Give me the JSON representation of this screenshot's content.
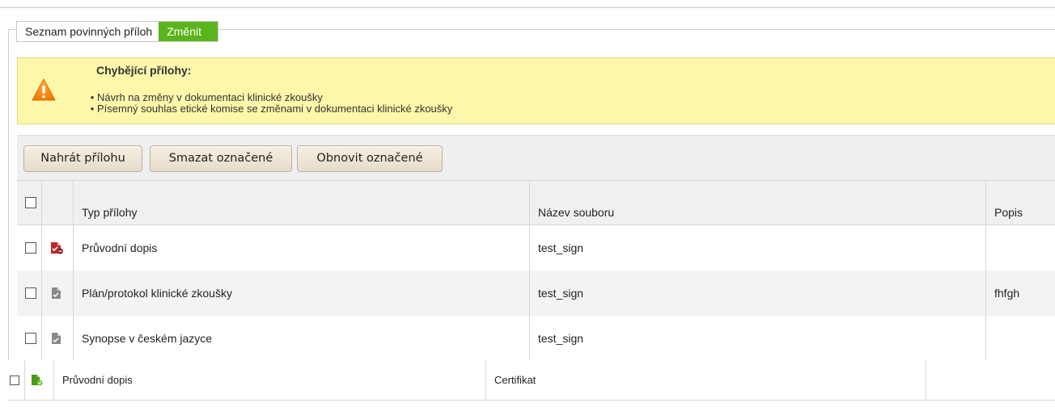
{
  "section": {
    "title": "Seznam povinných příloh",
    "action_label": "Změnit"
  },
  "warning": {
    "title": "Chybějící přílohy:",
    "items": [
      "Návrh na změny v dokumentaci klinické zkoušky",
      "Písemný souhlas etické komise se změnami v dokumentaci klinické zkoušky"
    ]
  },
  "toolbar": {
    "upload_label": "Nahrát přílohu",
    "delete_label": "Smazat označené",
    "restore_label": "Obnovit označené"
  },
  "table": {
    "columns": {
      "type": "Typ přílohy",
      "filename": "Název souboru",
      "description": "Popis"
    },
    "rows": [
      {
        "type": "Průvodní dopis",
        "filename": "test_sign",
        "description": "",
        "icon": "signed-document-red-icon"
      },
      {
        "type": "Plán/protokol klinické zkoušky",
        "filename": "test_sign",
        "description": "fhfgh",
        "icon": "signed-document-gray-icon"
      },
      {
        "type": "Synopse v českém jazyce",
        "filename": "test_sign",
        "description": "",
        "icon": "signed-document-gray-icon"
      }
    ]
  },
  "overlay_row": {
    "type": "Průvodní dopis",
    "filename": "Certifikat",
    "icon": "signed-document-green-icon"
  },
  "colors": {
    "accent_green": "#5ab51c",
    "warning_bg": "#fdf7aa",
    "alt_row_bg": "#f3f3f3",
    "header_bg": "#f0f0f0"
  }
}
